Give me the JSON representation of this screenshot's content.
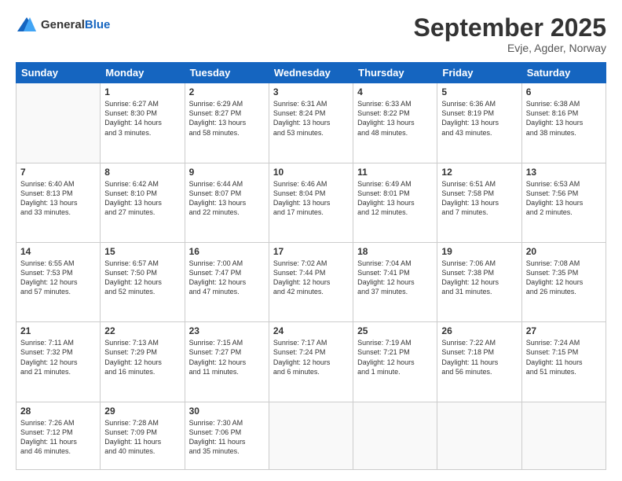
{
  "logo": {
    "general": "General",
    "blue": "Blue"
  },
  "header": {
    "month": "September 2025",
    "location": "Evje, Agder, Norway"
  },
  "days_of_week": [
    "Sunday",
    "Monday",
    "Tuesday",
    "Wednesday",
    "Thursday",
    "Friday",
    "Saturday"
  ],
  "weeks": [
    [
      {
        "day": "",
        "content": ""
      },
      {
        "day": "1",
        "content": "Sunrise: 6:27 AM\nSunset: 8:30 PM\nDaylight: 14 hours\nand 3 minutes."
      },
      {
        "day": "2",
        "content": "Sunrise: 6:29 AM\nSunset: 8:27 PM\nDaylight: 13 hours\nand 58 minutes."
      },
      {
        "day": "3",
        "content": "Sunrise: 6:31 AM\nSunset: 8:24 PM\nDaylight: 13 hours\nand 53 minutes."
      },
      {
        "day": "4",
        "content": "Sunrise: 6:33 AM\nSunset: 8:22 PM\nDaylight: 13 hours\nand 48 minutes."
      },
      {
        "day": "5",
        "content": "Sunrise: 6:36 AM\nSunset: 8:19 PM\nDaylight: 13 hours\nand 43 minutes."
      },
      {
        "day": "6",
        "content": "Sunrise: 6:38 AM\nSunset: 8:16 PM\nDaylight: 13 hours\nand 38 minutes."
      }
    ],
    [
      {
        "day": "7",
        "content": "Sunrise: 6:40 AM\nSunset: 8:13 PM\nDaylight: 13 hours\nand 33 minutes."
      },
      {
        "day": "8",
        "content": "Sunrise: 6:42 AM\nSunset: 8:10 PM\nDaylight: 13 hours\nand 27 minutes."
      },
      {
        "day": "9",
        "content": "Sunrise: 6:44 AM\nSunset: 8:07 PM\nDaylight: 13 hours\nand 22 minutes."
      },
      {
        "day": "10",
        "content": "Sunrise: 6:46 AM\nSunset: 8:04 PM\nDaylight: 13 hours\nand 17 minutes."
      },
      {
        "day": "11",
        "content": "Sunrise: 6:49 AM\nSunset: 8:01 PM\nDaylight: 13 hours\nand 12 minutes."
      },
      {
        "day": "12",
        "content": "Sunrise: 6:51 AM\nSunset: 7:58 PM\nDaylight: 13 hours\nand 7 minutes."
      },
      {
        "day": "13",
        "content": "Sunrise: 6:53 AM\nSunset: 7:56 PM\nDaylight: 13 hours\nand 2 minutes."
      }
    ],
    [
      {
        "day": "14",
        "content": "Sunrise: 6:55 AM\nSunset: 7:53 PM\nDaylight: 12 hours\nand 57 minutes."
      },
      {
        "day": "15",
        "content": "Sunrise: 6:57 AM\nSunset: 7:50 PM\nDaylight: 12 hours\nand 52 minutes."
      },
      {
        "day": "16",
        "content": "Sunrise: 7:00 AM\nSunset: 7:47 PM\nDaylight: 12 hours\nand 47 minutes."
      },
      {
        "day": "17",
        "content": "Sunrise: 7:02 AM\nSunset: 7:44 PM\nDaylight: 12 hours\nand 42 minutes."
      },
      {
        "day": "18",
        "content": "Sunrise: 7:04 AM\nSunset: 7:41 PM\nDaylight: 12 hours\nand 37 minutes."
      },
      {
        "day": "19",
        "content": "Sunrise: 7:06 AM\nSunset: 7:38 PM\nDaylight: 12 hours\nand 31 minutes."
      },
      {
        "day": "20",
        "content": "Sunrise: 7:08 AM\nSunset: 7:35 PM\nDaylight: 12 hours\nand 26 minutes."
      }
    ],
    [
      {
        "day": "21",
        "content": "Sunrise: 7:11 AM\nSunset: 7:32 PM\nDaylight: 12 hours\nand 21 minutes."
      },
      {
        "day": "22",
        "content": "Sunrise: 7:13 AM\nSunset: 7:29 PM\nDaylight: 12 hours\nand 16 minutes."
      },
      {
        "day": "23",
        "content": "Sunrise: 7:15 AM\nSunset: 7:27 PM\nDaylight: 12 hours\nand 11 minutes."
      },
      {
        "day": "24",
        "content": "Sunrise: 7:17 AM\nSunset: 7:24 PM\nDaylight: 12 hours\nand 6 minutes."
      },
      {
        "day": "25",
        "content": "Sunrise: 7:19 AM\nSunset: 7:21 PM\nDaylight: 12 hours\nand 1 minute."
      },
      {
        "day": "26",
        "content": "Sunrise: 7:22 AM\nSunset: 7:18 PM\nDaylight: 11 hours\nand 56 minutes."
      },
      {
        "day": "27",
        "content": "Sunrise: 7:24 AM\nSunset: 7:15 PM\nDaylight: 11 hours\nand 51 minutes."
      }
    ],
    [
      {
        "day": "28",
        "content": "Sunrise: 7:26 AM\nSunset: 7:12 PM\nDaylight: 11 hours\nand 46 minutes."
      },
      {
        "day": "29",
        "content": "Sunrise: 7:28 AM\nSunset: 7:09 PM\nDaylight: 11 hours\nand 40 minutes."
      },
      {
        "day": "30",
        "content": "Sunrise: 7:30 AM\nSunset: 7:06 PM\nDaylight: 11 hours\nand 35 minutes."
      },
      {
        "day": "",
        "content": ""
      },
      {
        "day": "",
        "content": ""
      },
      {
        "day": "",
        "content": ""
      },
      {
        "day": "",
        "content": ""
      }
    ]
  ]
}
